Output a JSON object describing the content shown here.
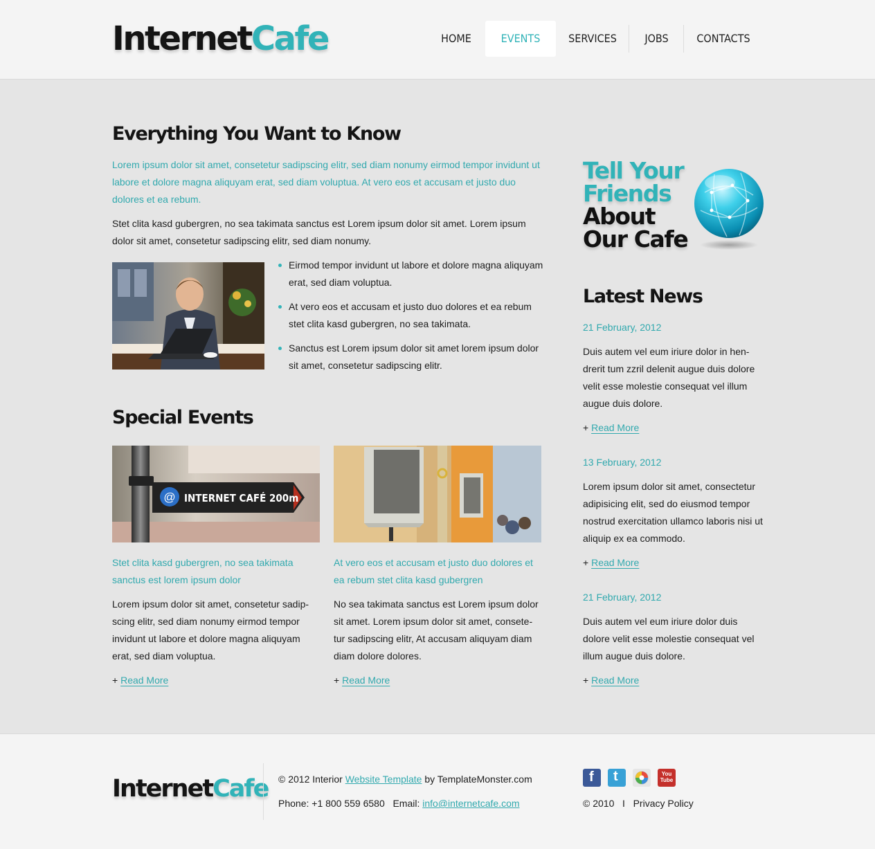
{
  "header": {
    "logo": {
      "part1": "Internet",
      "part2": "Cafe"
    },
    "nav": [
      {
        "label": "HOME"
      },
      {
        "label": "EVENTS",
        "active": true
      },
      {
        "label": "SERVICES"
      },
      {
        "label": "JOBS"
      },
      {
        "label": "CONTACTS"
      }
    ]
  },
  "main": {
    "intro": {
      "title": "Everything You Want to Know",
      "lead": "Lorem ipsum dolor sit amet, consetetur sadipscing elitr, sed diam nonumy eirmod tempor invidunt ut labore et dolore magna aliquyam erat, sed diam voluptua. At vero eos et accusam et justo duo dolores et ea rebum.",
      "body": "Stet clita kasd gubergren, no sea takimata sanctus est Lorem ipsum dolor sit amet. Lorem ipsum dolor sit amet, consetetur sadipscing elitr, sed diam nonumy.",
      "bullets": [
        "Eirmod tempor invidunt ut labore et dolore magna aliquyam erat, sed diam voluptua.",
        "At vero eos et accusam et justo duo dolores et ea rebum stet clita kasd gubergren, no sea takimata.",
        "Sanctus est Lorem ipsum dolor sit amet lorem ipsum dolor sit amet, consetetur sadipscing elitr."
      ]
    },
    "events": {
      "title": "Special Events",
      "sign_text": "INTERNET CAFÉ 200m",
      "sign_at": "@",
      "items": [
        {
          "heading": "Stet clita kasd gubergren, no sea takimata sanctus est lorem ipsum dolor",
          "body": "Lorem ipsum dolor sit amet, consetetur sadip-scing elitr, sed diam nonumy eirmod tempor invidunt ut labore et dolore magna aliquyam erat, sed diam voluptua.",
          "read_more": "Read More"
        },
        {
          "heading": "At vero eos et accusam et justo duo dolores et ea rebum stet clita kasd gubergren",
          "body": "No sea takimata sanctus est Lorem ipsum dolor sit amet. Lorem ipsum dolor sit amet, consete-tur sadipscing elitr, At accusam aliquyam diam diam dolore dolores.",
          "read_more": "Read More"
        }
      ]
    }
  },
  "sidebar": {
    "promo": {
      "line1": "Tell Your",
      "line2": "Friends",
      "line3": "About",
      "line4": "Our Cafe"
    },
    "news_title": "Latest News",
    "news": [
      {
        "date": "21 February, 2012",
        "body": "Duis autem vel eum iriure dolor in hen-drerit tum zzril delenit augue duis dolore velit esse molestie consequat vel illum augue duis dolore.",
        "read_more": "Read More"
      },
      {
        "date": "13 February, 2012",
        "body": "Lorem ipsum dolor sit amet, consectetur adipisicing elit, sed do eiusmod tempor nostrud exercitation ullamco laboris nisi ut aliquip ex ea commodo.",
        "read_more": "Read More"
      },
      {
        "date": "21 February, 2012",
        "body": "Duis autem vel eum iriure dolor  duis dolore velit esse molestie consequat vel illum augue duis dolore.",
        "read_more": "Read More"
      }
    ]
  },
  "footer": {
    "logo": {
      "part1": "Internet",
      "part2": "Cafe"
    },
    "copyright_prefix": "© 2012 Interior",
    "template_link": "Website Template",
    "copyright_suffix": "by TemplateMonster.com",
    "phone_label": "Phone: +1 800 559 6580",
    "email_label": "Email:",
    "email": "info@internetcafe.com",
    "site_copyright": "© 2010",
    "separator": "I",
    "privacy": "Privacy Policy",
    "social": [
      {
        "icon": "facebook-icon",
        "glyph": "f",
        "color": "#3b5998"
      },
      {
        "icon": "twitter-icon",
        "glyph": "t",
        "color": "#38a1d6"
      },
      {
        "icon": "picasa-icon",
        "glyph": "",
        "color": "#e6e6e6"
      },
      {
        "icon": "youtube-icon",
        "glyph": "You Tube",
        "color": "#c4302b"
      }
    ]
  },
  "colors": {
    "accent": "#31b3b8",
    "link": "#31a9ae",
    "text": "#1c1c1c",
    "background": "#e5e5e5",
    "header_bg": "#f4f4f4"
  }
}
